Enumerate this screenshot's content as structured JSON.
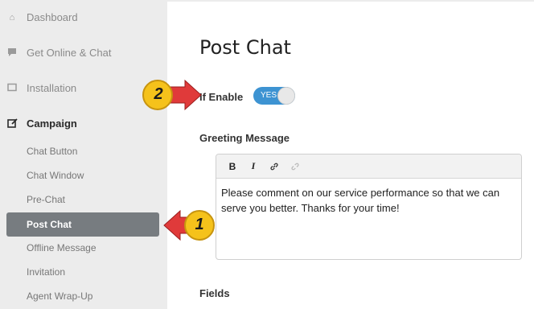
{
  "sidebar": {
    "items": [
      {
        "label": "Dashboard",
        "icon": "home-icon"
      },
      {
        "label": "Get Online & Chat",
        "icon": "chat-bubble-icon"
      },
      {
        "label": "Installation",
        "icon": "monitor-icon"
      },
      {
        "label": "Campaign",
        "icon": "edit-icon"
      }
    ],
    "sub_items": [
      {
        "label": "Chat Button"
      },
      {
        "label": "Chat Window"
      },
      {
        "label": "Pre-Chat"
      },
      {
        "label": "Post Chat"
      },
      {
        "label": "Offline Message"
      },
      {
        "label": "Invitation"
      },
      {
        "label": "Agent Wrap-Up"
      }
    ]
  },
  "main": {
    "title": "Post Chat",
    "enable_label": "If Enable",
    "toggle": {
      "text": "YES",
      "on": true
    },
    "greeting_label": "Greeting Message",
    "greeting_text": "Please comment on our service performance so that we can serve you better. Thanks for your time!",
    "fields_label": "Fields",
    "toolbar": {
      "bold": "B",
      "italic": "I"
    }
  },
  "callouts": {
    "one": "1",
    "two": "2"
  },
  "colors": {
    "accent": "#3d93d2",
    "selected_bg": "#777c80",
    "arrow": "#e03a3a",
    "badge": "#f5c21b"
  }
}
